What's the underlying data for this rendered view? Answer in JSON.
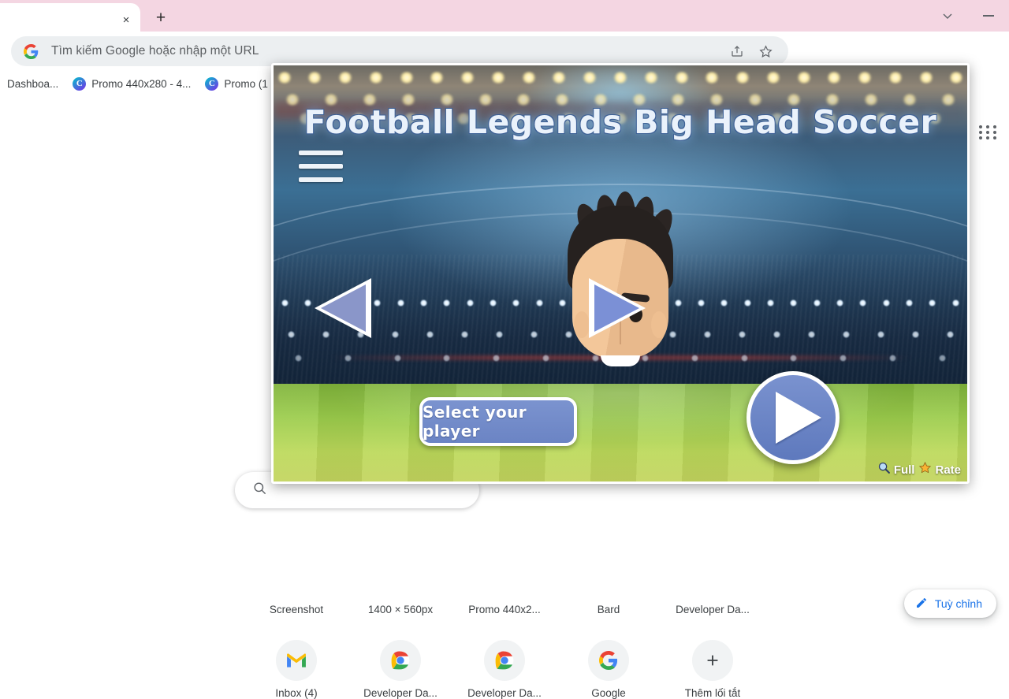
{
  "window": {
    "tab_close_label": "×",
    "new_tab_label": "+",
    "tab_search_label": "∨",
    "minimize_label": "",
    "accent_tabstrip": "#f4d6e2"
  },
  "omnibox": {
    "placeholder": "Tìm kiếm Google hoặc nhập một URL",
    "value": "",
    "icons": [
      "google-g-icon",
      "share-icon",
      "bookmark-star-icon"
    ]
  },
  "extensions": [
    {
      "name": "extension-icon-1",
      "glyph": "🐦",
      "bg": "#8fd3f4"
    },
    {
      "name": "extension-icon-2",
      "glyph": "🏒",
      "bg": "#ffffff"
    },
    {
      "name": "extension-icon-3",
      "glyph": "⚽",
      "bg": "#2f6b2f"
    },
    {
      "name": "extension-icon-4",
      "glyph": "🛶",
      "bg": "#d9e6f2"
    },
    {
      "name": "extension-icon-5",
      "glyph": "🤸",
      "bg": "#f7b733"
    },
    {
      "name": "extension-icon-6",
      "glyph": "⚽",
      "bg": "#7ea8d8"
    }
  ],
  "puzzle_icon": "extensions-puzzle-icon",
  "bookmarks": [
    {
      "label": "Dashboa...",
      "icon": null
    },
    {
      "label": "Promo 440x280 - 4...",
      "icon": "C"
    },
    {
      "label": "Promo (1",
      "icon": "C"
    }
  ],
  "ntp": {
    "apps_grid_icon": "google-apps-grid-icon",
    "search_placeholder": "",
    "search_icon": "search-icon",
    "shortcuts_row1": [
      {
        "label": "Screenshot"
      },
      {
        "label": "1400 × 560px"
      },
      {
        "label": "Promo 440x2..."
      },
      {
        "label": "Bard"
      },
      {
        "label": "Developer Da..."
      }
    ],
    "shortcuts_row2": [
      {
        "label": "Inbox (4)",
        "icon": "gmail-icon"
      },
      {
        "label": "Developer Da...",
        "icon": "chrome-icon"
      },
      {
        "label": "Developer Da...",
        "icon": "chrome-icon"
      },
      {
        "label": "Google",
        "icon": "google-g-icon"
      },
      {
        "label": "Thêm lối tắt",
        "icon": "plus-icon"
      }
    ],
    "customize": {
      "label": "Tuỳ chỉnh",
      "icon": "pencil-icon",
      "color": "#1a73e8"
    }
  },
  "game": {
    "title": "Football Legends Big Head Soccer",
    "menu_icon": "hamburger-menu-icon",
    "select_button_label": "Select your player",
    "play_button_icon": "play-circle-icon",
    "prev_icon": "arrow-left-icon",
    "next_icon": "arrow-right-icon",
    "character": "footballer-big-head-avatar",
    "footer": [
      {
        "label": "Full",
        "icon": "magnifier-icon"
      },
      {
        "label": "Rate",
        "icon": "star-icon"
      }
    ],
    "accent_blue": "#7b90d6",
    "pitch_green": "#9ccd4c"
  }
}
